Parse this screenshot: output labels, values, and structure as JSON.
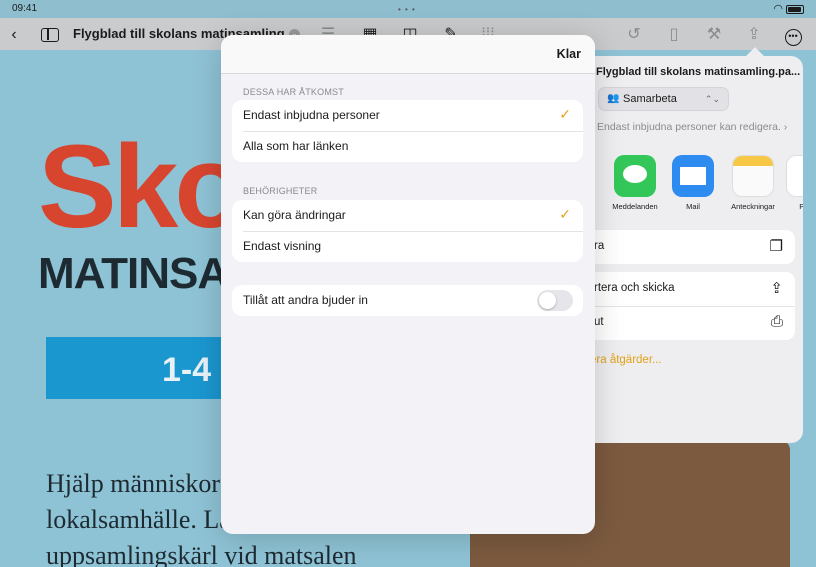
{
  "status_bar": {
    "time": "09:41",
    "indicator_dots": "• • •"
  },
  "toolbar": {
    "document_title": "Flygblad till skolans matinsamling",
    "title_menu_glyph": "⌄",
    "icons": [
      "back-icon",
      "sidebar-icon",
      "list-icon",
      "table-icon",
      "shapes-icon",
      "pen-icon",
      "grid-icon",
      "undo-icon",
      "trash-icon",
      "format-icon",
      "share-icon",
      "more-icon"
    ]
  },
  "document": {
    "headline": "Skol",
    "subheadline": "MATINSAMLING",
    "band_text": "1-4",
    "body_lines": [
      "Hjälp människor i vårt",
      "lokalsamhälle. Lämna",
      "uppsamlingskärl vid matsalen"
    ]
  },
  "share_sheet": {
    "title": "Flygblad till skolans matinsamling.pa...",
    "collaborate_label": "Samarbeta",
    "access_summary": "Endast inbjudna personer kan redigera.",
    "apps": [
      {
        "label": "Meddelanden",
        "icon": "messages-icon"
      },
      {
        "label": "Mail",
        "icon": "mail-icon"
      },
      {
        "label": "Anteckningar",
        "icon": "notes-icon"
      },
      {
        "label": "Påm",
        "icon": "reminders-icon"
      }
    ],
    "actions": [
      {
        "label": "ra",
        "icon": "copy-icon"
      },
      {
        "label": "rtera och skicka",
        "icon": "export-icon"
      },
      {
        "label": "ut",
        "icon": "print-icon"
      }
    ],
    "edit_actions_label": "era åtgärder...",
    "accent_color": "#E2A21A"
  },
  "modal": {
    "done_label": "Klar",
    "access_section": {
      "header": "DESSA HAR ÅTKOMST",
      "options": [
        {
          "label": "Endast inbjudna personer",
          "selected": true
        },
        {
          "label": "Alla som har länken",
          "selected": false
        }
      ]
    },
    "permissions_section": {
      "header": "BEHÖRIGHETER",
      "options": [
        {
          "label": "Kan göra ändringar",
          "selected": true
        },
        {
          "label": "Endast visning",
          "selected": false
        }
      ]
    },
    "invite_toggle": {
      "label": "Tillåt att andra bjuder in",
      "on": false
    },
    "checkmark_glyph": "✓",
    "checkmark_color": "#E2A21A"
  }
}
